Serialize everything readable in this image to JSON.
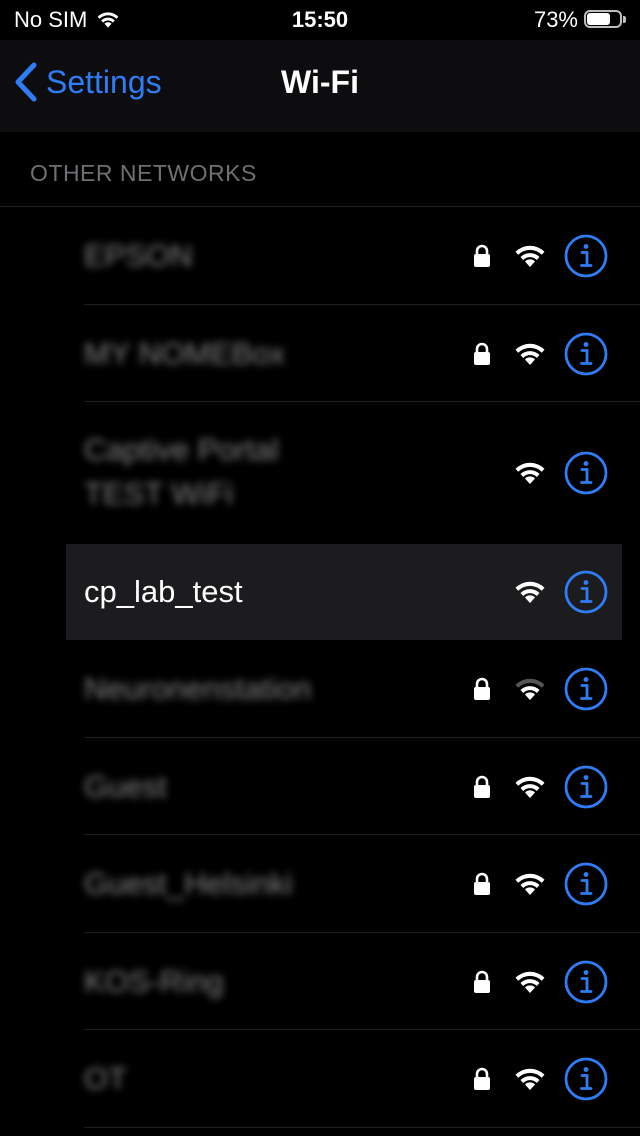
{
  "status_bar": {
    "carrier": "No SIM",
    "time": "15:50",
    "battery_percent": "73%",
    "battery_level": 0.73
  },
  "nav": {
    "back_label": "Settings",
    "title": "Wi-Fi"
  },
  "section_header": "OTHER NETWORKS",
  "networks": [
    {
      "name": "EPSON",
      "name_line2": "",
      "locked": true,
      "signal": 3,
      "selected": false,
      "obscured": true
    },
    {
      "name": "MY NOMEBox",
      "name_line2": "",
      "locked": true,
      "signal": 3,
      "selected": false,
      "obscured": true
    },
    {
      "name": "Captive Portal",
      "name_line2": "TEST WiFi",
      "locked": false,
      "signal": 3,
      "selected": false,
      "obscured": true
    },
    {
      "name": "cp_lab_test",
      "name_line2": "",
      "locked": false,
      "signal": 3,
      "selected": true,
      "obscured": false
    },
    {
      "name": "Neuronenstation",
      "name_line2": "",
      "locked": true,
      "signal": 2,
      "selected": false,
      "obscured": true
    },
    {
      "name": "Guest",
      "name_line2": "",
      "locked": true,
      "signal": 3,
      "selected": false,
      "obscured": true
    },
    {
      "name": "Guest_Helsinki",
      "name_line2": "",
      "locked": true,
      "signal": 3,
      "selected": false,
      "obscured": true
    },
    {
      "name": "KOS-Ring",
      "name_line2": "",
      "locked": true,
      "signal": 3,
      "selected": false,
      "obscured": true
    },
    {
      "name": "OT",
      "name_line2": "",
      "locked": true,
      "signal": 3,
      "selected": false,
      "obscured": true
    }
  ],
  "colors": {
    "accent": "#2f7df6",
    "background": "#000000",
    "selected_row": "#1c1c1e"
  },
  "icons": {
    "lock": "lock-icon",
    "wifi": "wifi-icon",
    "info": "info-icon",
    "back": "chevron-left-icon"
  }
}
